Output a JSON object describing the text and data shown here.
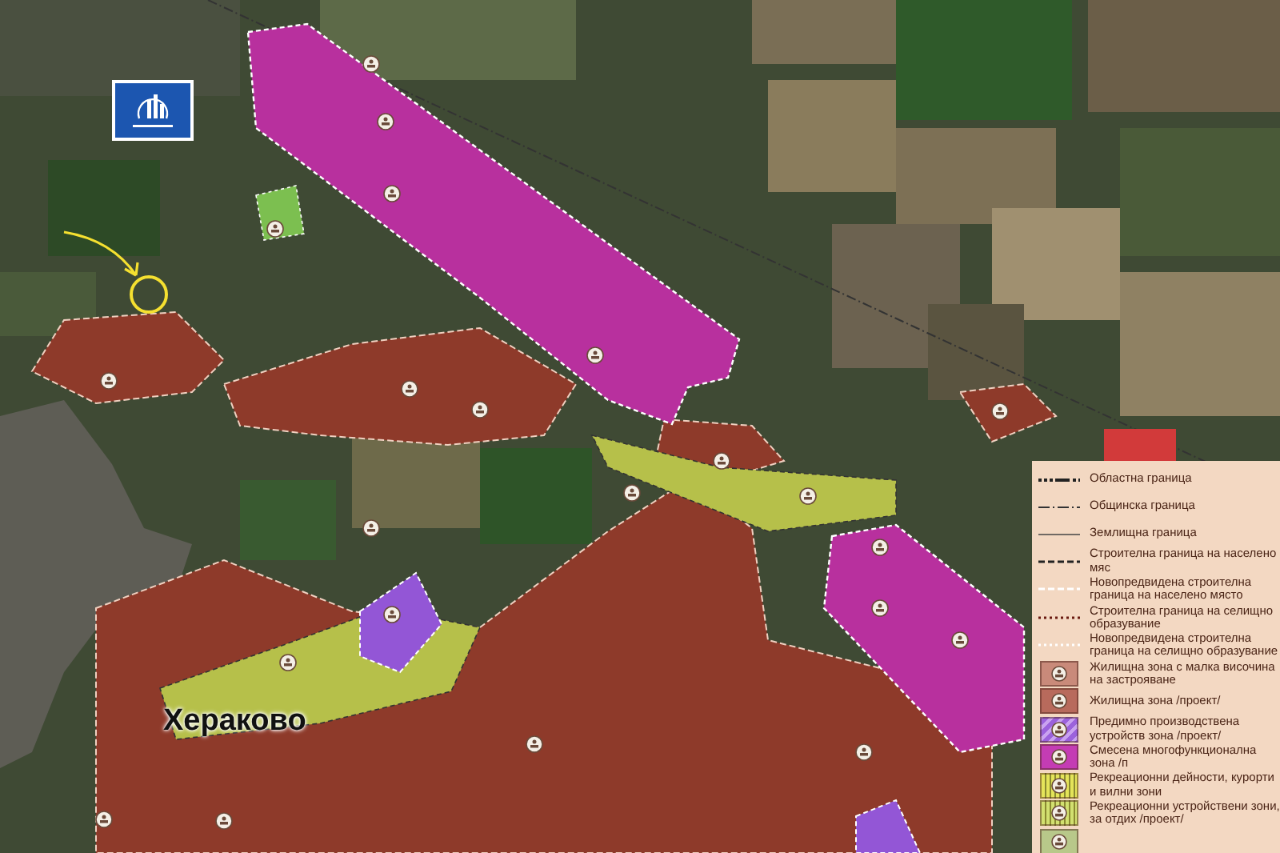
{
  "map": {
    "place_label": "Хераково"
  },
  "legend": {
    "items": [
      {
        "kind": "line",
        "label": "Областна граница"
      },
      {
        "kind": "line",
        "label": "Общинска граница"
      },
      {
        "kind": "line",
        "label": "Землищна граница"
      },
      {
        "kind": "line",
        "label": "Строителна граница на населено мяс"
      },
      {
        "kind": "line",
        "label": "Новопредвидена строителна граница на населено място"
      },
      {
        "kind": "line",
        "label": "Строителна граница на селищно образувание"
      },
      {
        "kind": "line",
        "label": "Новопредвидена строителна граница на селищно образувание"
      },
      {
        "kind": "swatch",
        "color": "#c98a7a",
        "label": "Жилищна зона с малка височина на застрояване"
      },
      {
        "kind": "swatch",
        "color": "#b86a5c",
        "label": "Жилищна зона /проект/"
      },
      {
        "kind": "swatch",
        "color": "#9b62dc",
        "label": "Предимно производствена устройств зона /проект/"
      },
      {
        "kind": "swatch",
        "color": "#c43cb4",
        "label": "Смесена многофункционална зона /п"
      },
      {
        "kind": "swatch",
        "color": "#e4e45a",
        "label": "Рекреационни дейности, курорти и вилни зони"
      },
      {
        "kind": "swatch",
        "color": "#d2e070",
        "label": "Рекреационни устройствени зони, за отдих /проект/"
      },
      {
        "kind": "swatch",
        "color": "#b8c88a"
      }
    ]
  }
}
